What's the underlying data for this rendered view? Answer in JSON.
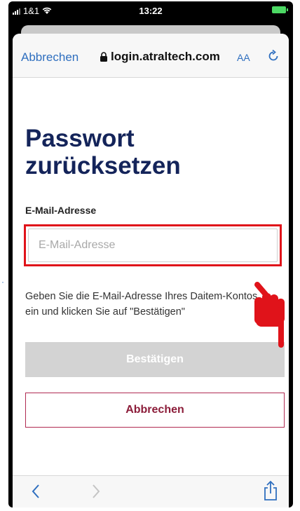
{
  "status_bar": {
    "carrier": "1&1",
    "time": "13:22"
  },
  "browser": {
    "cancel_label": "Abbrechen",
    "url": "login.atraltech.com",
    "text_size_label": "AA"
  },
  "page": {
    "title": "Passwort zurücksetzen",
    "email_label": "E-Mail-Adresse",
    "email_placeholder": "E-Mail-Adresse",
    "email_value": "",
    "helper_text": "Geben Sie die E-Mail-Adresse Ihres Daitem-Kontos ein und klicken Sie auf \"Bestätigen\"",
    "confirm_button": "Bestätigen",
    "cancel_button": "Abbrechen"
  },
  "colors": {
    "title": "#14245a",
    "link": "#2f6fbf",
    "highlight": "#e0131a",
    "cancel_border": "#b02a52",
    "confirm_disabled": "#d3d3d3"
  },
  "icons": [
    "wifi-icon",
    "battery-icon",
    "lock-icon",
    "reload-icon",
    "back-icon",
    "forward-icon",
    "share-icon",
    "pointing-hand-icon"
  ]
}
